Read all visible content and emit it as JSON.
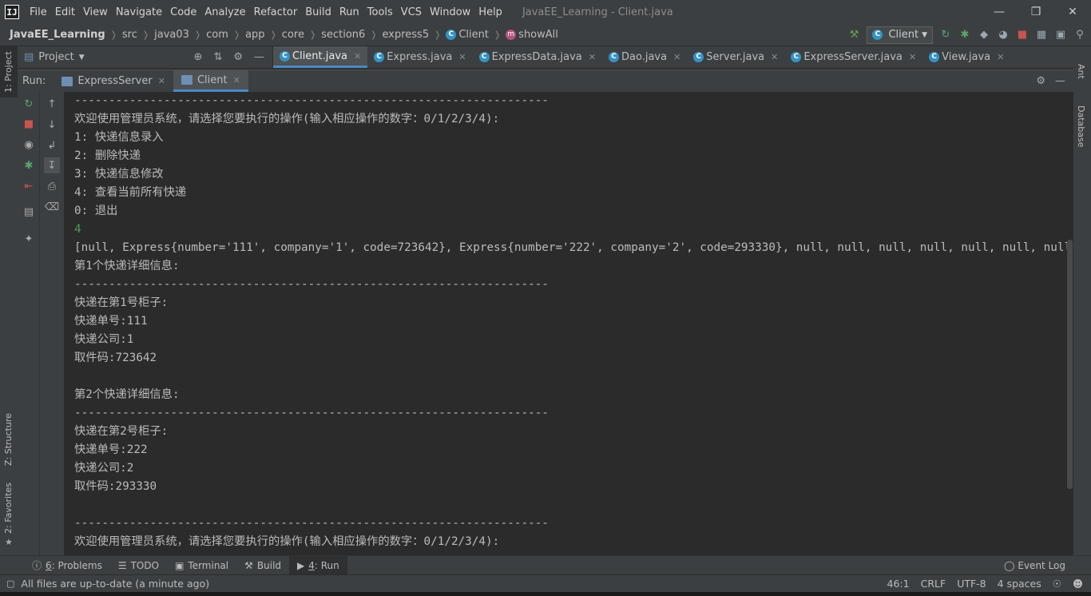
{
  "menu": [
    "File",
    "Edit",
    "View",
    "Navigate",
    "Code",
    "Analyze",
    "Refactor",
    "Build",
    "Run",
    "Tools",
    "VCS",
    "Window",
    "Help"
  ],
  "window_title": "JavaEE_Learning - Client.java",
  "breadcrumbs": [
    "JavaEE_Learning",
    "src",
    "java03",
    "com",
    "app",
    "core",
    "section6",
    "express5",
    "Client",
    "showAll"
  ],
  "run_config": "Client",
  "project_panel": {
    "label": "Project"
  },
  "editor_tabs": [
    "Client.java",
    "Express.java",
    "ExpressData.java",
    "Dao.java",
    "Server.java",
    "ExpressServer.java",
    "View.java"
  ],
  "run_panel": {
    "label": "Run:",
    "tabs": [
      "ExpressServer",
      "Client"
    ]
  },
  "left_strip": {
    "project": "1: Project",
    "structure": "Z: Structure",
    "favorites": "2: Favorites"
  },
  "right_strip": {
    "ant": "Ant",
    "database": "Database"
  },
  "console_lines": [
    {
      "text": "---------------------------------------------------------------------",
      "style": "normal"
    },
    {
      "text": "欢迎使用管理员系统，请选择您要执行的操作(输入相应操作的数字：0/1/2/3/4):",
      "style": "normal"
    },
    {
      "text": "1: 快递信息录入",
      "style": "normal"
    },
    {
      "text": "2: 删除快递",
      "style": "normal"
    },
    {
      "text": "3: 快递信息修改",
      "style": "normal"
    },
    {
      "text": "4: 查看当前所有快递",
      "style": "normal"
    },
    {
      "text": "0: 退出",
      "style": "normal"
    },
    {
      "text": "4",
      "style": "green"
    },
    {
      "text": "[null, Express{number='111', company='1', code=723642}, Express{number='222', company='2', code=293330}, null, null, null, null, null, null, null",
      "style": "normal"
    },
    {
      "text": "第1个快递详细信息:",
      "style": "normal"
    },
    {
      "text": "---------------------------------------------------------------------",
      "style": "normal"
    },
    {
      "text": "快递在第1号柜子:",
      "style": "normal"
    },
    {
      "text": "快递单号:111",
      "style": "normal"
    },
    {
      "text": "快递公司:1",
      "style": "normal"
    },
    {
      "text": "取件码:723642",
      "style": "normal"
    },
    {
      "text": "",
      "style": "normal"
    },
    {
      "text": "第2个快递详细信息:",
      "style": "normal"
    },
    {
      "text": "---------------------------------------------------------------------",
      "style": "normal"
    },
    {
      "text": "快递在第2号柜子:",
      "style": "normal"
    },
    {
      "text": "快递单号:222",
      "style": "normal"
    },
    {
      "text": "快递公司:2",
      "style": "normal"
    },
    {
      "text": "取件码:293330",
      "style": "normal"
    },
    {
      "text": "",
      "style": "normal"
    },
    {
      "text": "---------------------------------------------------------------------",
      "style": "normal"
    },
    {
      "text": "欢迎使用管理员系统，请选择您要执行的操作(输入相应操作的数字：0/1/2/3/4):",
      "style": "normal"
    }
  ],
  "bottom_tabs": [
    {
      "key": "6",
      "label": ": Problems",
      "icon": "problems-icon"
    },
    {
      "key": "",
      "label": "TODO",
      "icon": "todo-icon"
    },
    {
      "key": "",
      "label": "Terminal",
      "icon": "terminal-icon"
    },
    {
      "key": "",
      "label": "Build",
      "icon": "build-icon"
    },
    {
      "key": "4",
      "label": ": Run",
      "icon": "run-icon"
    }
  ],
  "event_log": "Event Log",
  "status": {
    "message": "All files are up-to-date (a minute ago)",
    "position": "46:1",
    "line_sep": "CRLF",
    "encoding": "UTF-8",
    "indent": "4 spaces"
  },
  "colors": {
    "accent": "#4a88c7",
    "console_green": "#499c54",
    "stop_red": "#c75450",
    "run_green": "#499c54"
  }
}
